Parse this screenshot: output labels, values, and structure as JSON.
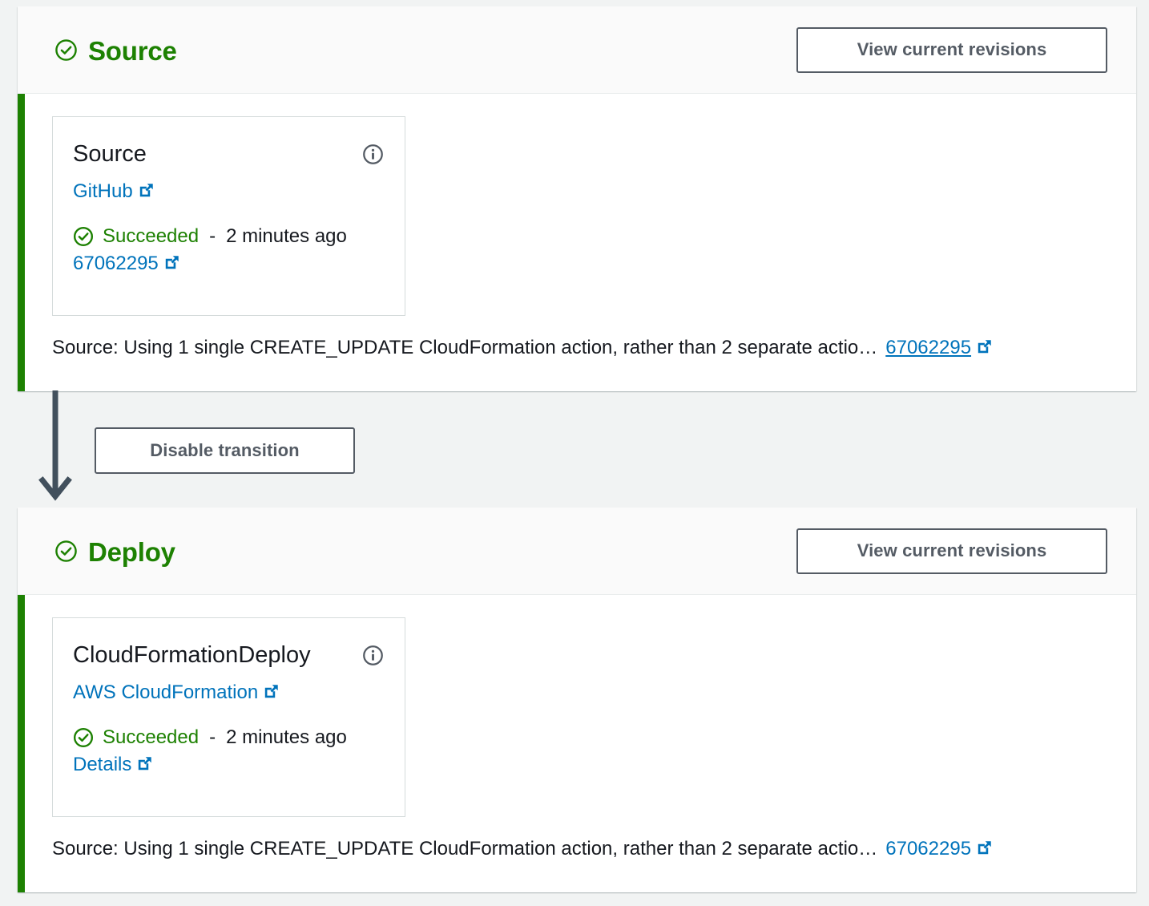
{
  "theme": {
    "stage_accent_color": "#1d8102",
    "success_color": "#1d8102",
    "link_color": "#0073bb",
    "button_border_color": "#545b64",
    "page_background": "#f1f3f3"
  },
  "stages": [
    {
      "name": "Source",
      "status_icon": "check-circle-icon",
      "view_revisions_label": "View current revisions",
      "action": {
        "name": "Source",
        "info_icon": "info-icon",
        "provider": "GitHub",
        "provider_external_icon": "external-link-icon",
        "status": "Succeeded",
        "status_separator": "-",
        "status_time": "2 minutes ago",
        "detail_link": "67062295",
        "detail_external_icon": "external-link-icon"
      },
      "revision_summary": {
        "text": "Source: Using 1 single CREATE_UPDATE CloudFormation action, rather than 2 separate actio…",
        "link": "67062295",
        "external_icon": "external-link-icon"
      }
    },
    {
      "name": "Deploy",
      "status_icon": "check-circle-icon",
      "view_revisions_label": "View current revisions",
      "action": {
        "name": "CloudFormationDeploy",
        "info_icon": "info-icon",
        "provider": "AWS CloudFormation",
        "provider_external_icon": "external-link-icon",
        "status": "Succeeded",
        "status_separator": "-",
        "status_time": "2 minutes ago",
        "detail_link": "Details",
        "detail_external_icon": "external-link-icon"
      },
      "revision_summary": {
        "text": "Source: Using 1 single CREATE_UPDATE CloudFormation action, rather than 2 separate actio…",
        "link": "67062295",
        "external_icon": "external-link-icon"
      }
    }
  ],
  "transition": {
    "button_label": "Disable transition",
    "arrow_icon": "down-arrow-icon"
  }
}
